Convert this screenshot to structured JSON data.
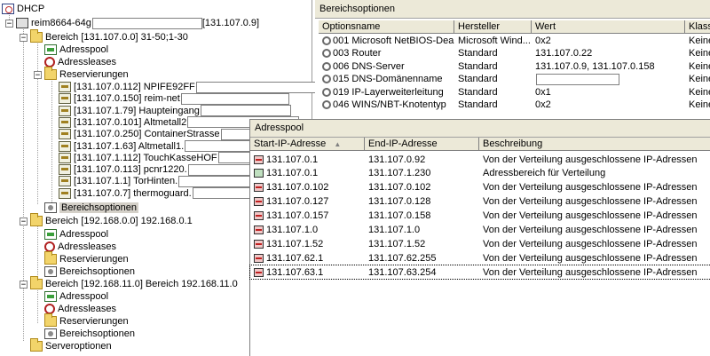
{
  "tree": {
    "root": "DHCP",
    "server": {
      "name": "reim8664-64g",
      "ip": "[131.107.0.9]"
    },
    "scope1": {
      "label": "Bereich [131.107.0.0] 31-50;1-30",
      "adresspool": "Adresspool",
      "adressleases": "Adressleases",
      "reservierungen": "Reservierungen",
      "reservations": [
        "[131.107.0.112] NPIFE92FF",
        "[131.107.0.150] reim-net",
        "[131.107.1.79] Haupteingang",
        "[131.107.0.101] Altmetall2",
        "[131.107.0.250] ContainerStrasse",
        "[131.107.1.63] Altmetall1.",
        "[131.107.1.112] TouchKasseHOF",
        "[131.107.0.113] pcnr1220.",
        "[131.107.1.1] TorHinten.",
        "[131.107.0.7] thermoguard."
      ],
      "bereichsoptionen": "Bereichsoptionen"
    },
    "scope2": {
      "label": "Bereich [192.168.0.0] 192.168.0.1",
      "adresspool": "Adresspool",
      "adressleases": "Adressleases",
      "reservierungen": "Reservierungen",
      "bereichsoptionen": "Bereichsoptionen"
    },
    "scope3": {
      "label": "Bereich [192.168.11.0] Bereich 192.168.11.0",
      "adresspool": "Adresspool",
      "adressleases": "Adressleases",
      "reservierungen": "Reservierungen",
      "bereichsoptionen": "Bereichsoptionen"
    },
    "serveroptionen": "Serveroptionen"
  },
  "options": {
    "title": "Bereichsoptionen",
    "columns": [
      "Optionsname",
      "Hersteller",
      "Wert",
      "Klasse"
    ],
    "rows": [
      [
        "001 Microsoft NetBIOS-Deak...",
        "Microsoft Wind...",
        "0x2",
        "Keine"
      ],
      [
        "003 Router",
        "Standard",
        "131.107.0.22",
        "Keine"
      ],
      [
        "006 DNS-Server",
        "Standard",
        "131.107.0.9, 131.107.0.158",
        "Keine"
      ],
      [
        "015 DNS-Domänenname",
        "Standard",
        "",
        "Keine"
      ],
      [
        "019 IP-Layerweiterleitung",
        "Standard",
        "0x1",
        "Keine"
      ],
      [
        "046 WINS/NBT-Knotentyp",
        "Standard",
        "0x2",
        "Keine"
      ]
    ]
  },
  "pool": {
    "title": "Adresspool",
    "columns": [
      "Start-IP-Adresse",
      "End-IP-Adresse",
      "Beschreibung"
    ],
    "sort_indicator": "▲",
    "rows": [
      {
        "start": "131.107.0.1",
        "end": "131.107.0.92",
        "desc": "Von der Verteilung ausgeschlossene IP-Adressen",
        "type": "ex"
      },
      {
        "start": "131.107.0.1",
        "end": "131.107.1.230",
        "desc": "Adressbereich für Verteilung",
        "type": "range"
      },
      {
        "start": "131.107.0.102",
        "end": "131.107.0.102",
        "desc": "Von der Verteilung ausgeschlossene IP-Adressen",
        "type": "ex"
      },
      {
        "start": "131.107.0.127",
        "end": "131.107.0.128",
        "desc": "Von der Verteilung ausgeschlossene IP-Adressen",
        "type": "ex"
      },
      {
        "start": "131.107.0.157",
        "end": "131.107.0.158",
        "desc": "Von der Verteilung ausgeschlossene IP-Adressen",
        "type": "ex"
      },
      {
        "start": "131.107.1.0",
        "end": "131.107.1.0",
        "desc": "Von der Verteilung ausgeschlossene IP-Adressen",
        "type": "ex"
      },
      {
        "start": "131.107.1.52",
        "end": "131.107.1.52",
        "desc": "Von der Verteilung ausgeschlossene IP-Adressen",
        "type": "ex"
      },
      {
        "start": "131.107.62.1",
        "end": "131.107.62.255",
        "desc": "Von der Verteilung ausgeschlossene IP-Adressen",
        "type": "ex"
      },
      {
        "start": "131.107.63.1",
        "end": "131.107.63.254",
        "desc": "Von der Verteilung ausgeschlossene IP-Adressen",
        "type": "ex"
      }
    ]
  }
}
